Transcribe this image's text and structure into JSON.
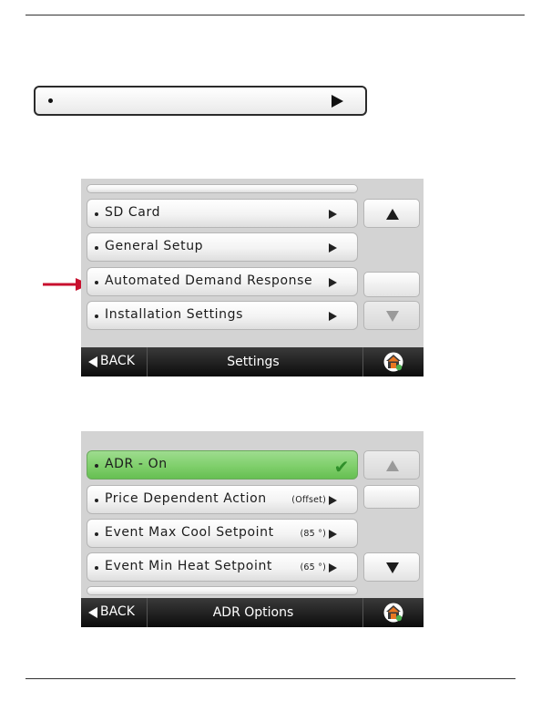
{
  "screen1": {
    "items": [
      {
        "label": "SD Card"
      },
      {
        "label": "General Setup"
      },
      {
        "label": "Automated Demand Response"
      },
      {
        "label": "Installation Settings"
      }
    ],
    "back_label": "BACK",
    "title": "Settings"
  },
  "screen2": {
    "items": [
      {
        "label": "ADR - On",
        "selected": true
      },
      {
        "label": "Price Dependent Action",
        "value": "(Offset)"
      },
      {
        "label": "Event Max Cool Setpoint",
        "value": "(85 °)"
      },
      {
        "label": "Event Min Heat Setpoint",
        "value": "(65 °)"
      }
    ],
    "back_label": "BACK",
    "title": "ADR Options"
  },
  "colors": {
    "pointer_arrow": "#c8102e",
    "selected_item": "#7fcf6b",
    "home_icon_roof": "#e87722"
  }
}
